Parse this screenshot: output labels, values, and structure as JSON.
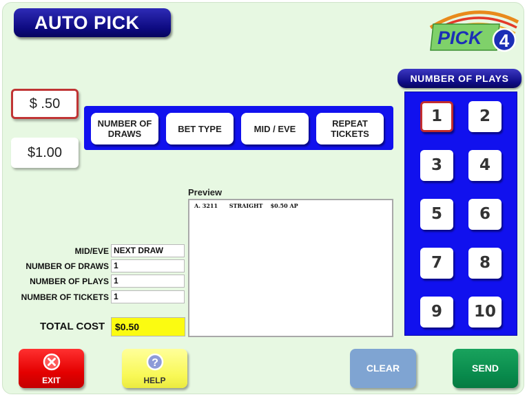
{
  "header": {
    "title": "AUTO PICK"
  },
  "logo": {
    "word": "PICK",
    "number": "4"
  },
  "number_of_plays": {
    "title": "NUMBER OF PLAYS",
    "buttons": [
      "1",
      "2",
      "3",
      "4",
      "5",
      "6",
      "7",
      "8",
      "9",
      "10"
    ],
    "selected": "1"
  },
  "price": {
    "options": [
      "$ .50",
      "$1.00"
    ],
    "selected": "$ .50"
  },
  "options_bar": {
    "number_of_draws": "NUMBER OF\nDRAWS",
    "bet_type": "BET TYPE",
    "mid_eve": "MID / EVE",
    "repeat_tickets": "REPEAT\nTICKETS"
  },
  "preview": {
    "label": "Preview",
    "line": {
      "index": "A.",
      "numbers": "3211",
      "bet": "STRAIGHT",
      "amount": "$0.50",
      "code": "AP"
    }
  },
  "summary": {
    "mid_eve": {
      "label": "MID/EVE",
      "value": "NEXT DRAW"
    },
    "number_of_draws": {
      "label": "NUMBER OF DRAWS",
      "value": "1"
    },
    "number_of_plays": {
      "label": "NUMBER OF PLAYS",
      "value": "1"
    },
    "number_of_tickets": {
      "label": "NUMBER OF TICKETS",
      "value": "1"
    }
  },
  "total": {
    "label": "TOTAL COST",
    "value": "$0.50"
  },
  "footer": {
    "exit": "EXIT",
    "help": "HELP",
    "clear": "CLEAR",
    "send": "SEND"
  },
  "icons": {
    "exit": "close-circle-icon",
    "help": "question-circle-icon"
  },
  "colors": {
    "title_blue": "#0d0a80",
    "panel_blue": "#1111ee",
    "exit_red": "#e40000",
    "help_yellow": "#f8f855",
    "clear_blue": "#7fa4d2",
    "send_green": "#08894b",
    "total_yellow": "#fbfb11",
    "selected_border": "#c32d2d"
  }
}
